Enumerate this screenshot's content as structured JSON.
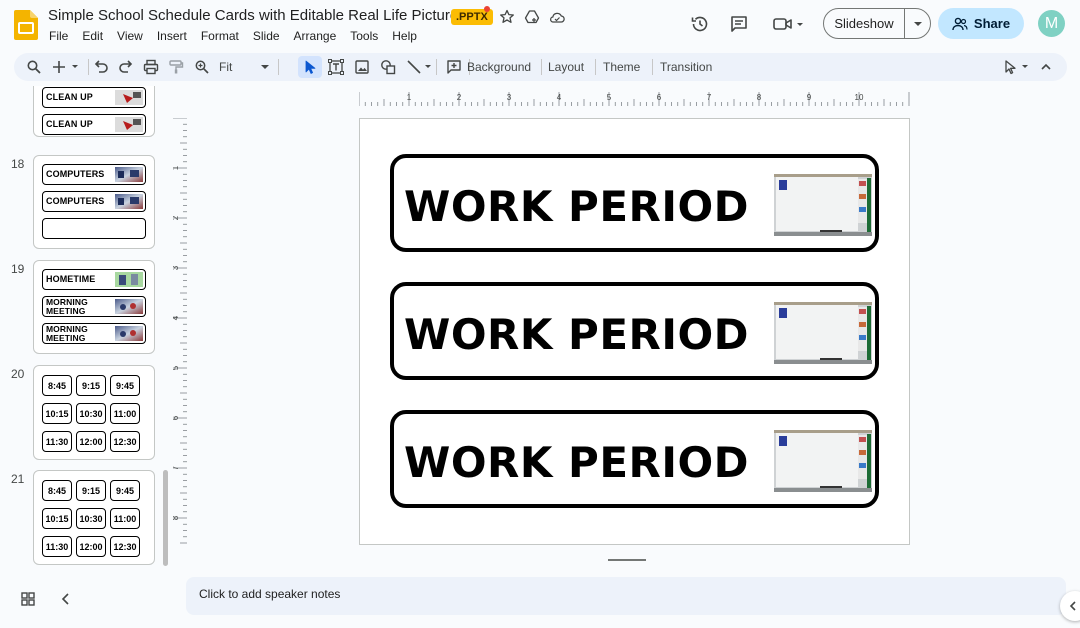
{
  "app": {
    "title": "Simple School Schedule Cards with Editable Real Life Pictures",
    "file_badge": ".PPTX",
    "accent_color": "#fbbc04"
  },
  "menu": [
    "File",
    "Edit",
    "View",
    "Insert",
    "Format",
    "Slide",
    "Arrange",
    "Tools",
    "Help"
  ],
  "header": {
    "slideshow_label": "Slideshow",
    "share_label": "Share",
    "avatar_initial": "M",
    "share_color": "#c2e7ff"
  },
  "toolbar": {
    "zoom_label": "Fit",
    "background_label": "Background",
    "layout_label": "Layout",
    "theme_label": "Theme",
    "transition_label": "Transition"
  },
  "ruler": {
    "h_labels": [
      "1",
      "2",
      "3",
      "4",
      "5",
      "6",
      "7",
      "8",
      "9",
      "10"
    ],
    "v_labels": [
      "1",
      "2",
      "3",
      "4",
      "5",
      "6",
      "7",
      "8"
    ]
  },
  "filmstrip": {
    "partial_slide": {
      "cards": [
        "CLEAN UP",
        "CLEAN UP"
      ]
    },
    "slides": [
      {
        "number": "18",
        "cards": [
          "COMPUTERS",
          "COMPUTERS",
          ""
        ]
      },
      {
        "number": "19",
        "cards": [
          "HOMETIME",
          "MORNING MEETING",
          "MORNING MEETING"
        ]
      },
      {
        "number": "20",
        "times": [
          "8:45",
          "9:15",
          "9:45",
          "10:15",
          "10:30",
          "11:00",
          "11:30",
          "12:00",
          "12:30"
        ]
      },
      {
        "number": "21",
        "times": [
          "8:45",
          "9:15",
          "9:45",
          "10:15",
          "10:30",
          "11:00",
          "11:30",
          "12:00",
          "12:30"
        ]
      }
    ]
  },
  "slide": {
    "cards": [
      "WORK PERIOD",
      "WORK PERIOD",
      "WORK PERIOD"
    ]
  },
  "notes": {
    "placeholder": "Click to add speaker notes"
  }
}
